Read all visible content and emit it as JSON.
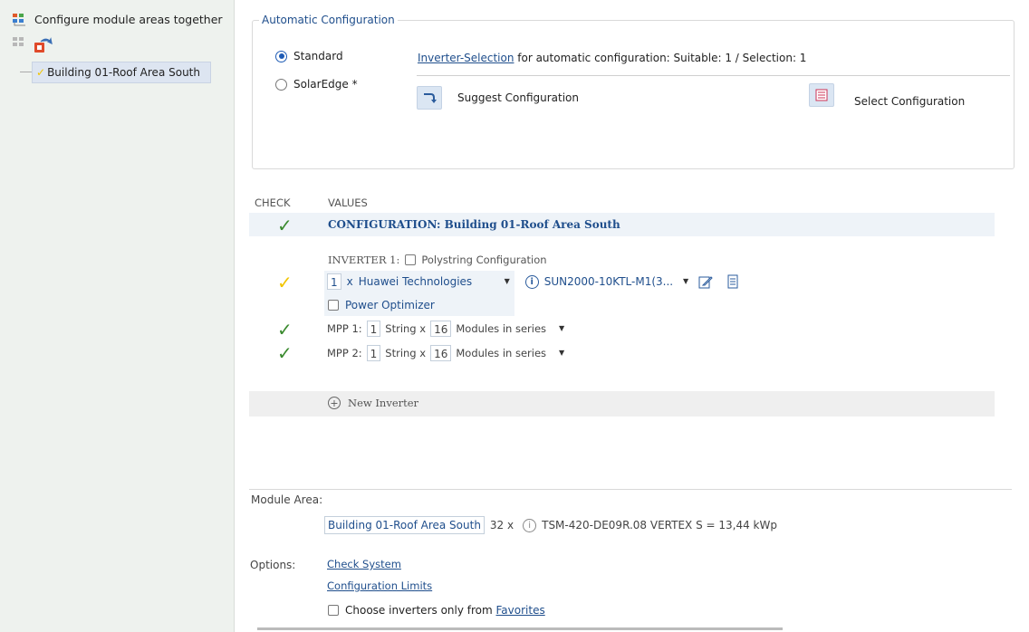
{
  "tree": {
    "title": "Configure module areas together",
    "node_label": "Building 01-Roof Area South"
  },
  "auto_config": {
    "legend": "Automatic Configuration",
    "radio_standard": "Standard",
    "radio_solaredge": "SolarEdge *",
    "inverter_selection_link": "Inverter-Selection",
    "inverter_selection_text": " for automatic configuration: Suitable: 1 / Selection: 1",
    "suggest_label": "Suggest Configuration",
    "select_label": "Select Configuration"
  },
  "check": {
    "col_check": "CHECK",
    "col_values": "VALUES",
    "config_title": "CONFIGURATION: Building 01-Roof Area South",
    "inverter_label": "INVERTER 1:",
    "polystring_label": "Polystring Configuration",
    "inverter_qty": "1",
    "times": "x",
    "manufacturer": "Huawei Technologies",
    "model": "SUN2000-10KTL-M1(3...",
    "power_optimizer_label": "Power Optimizer",
    "mpp": [
      {
        "label": "MPP 1:",
        "strings": "1",
        "string_x": "String x",
        "modules": "16",
        "modules_text": "Modules in series"
      },
      {
        "label": "MPP 2:",
        "strings": "1",
        "string_x": "String x",
        "modules": "16",
        "modules_text": "Modules in series"
      }
    ],
    "new_inverter_label": "New Inverter"
  },
  "module_area": {
    "label": "Module Area:",
    "area_name": "Building 01-Roof Area South",
    "count_text": "32  x",
    "module_text": "TSM-420-DE09R.08 VERTEX S  =  13,44 kWp"
  },
  "options": {
    "label": "Options:",
    "check_system": "Check System",
    "config_limits": "Configuration Limits",
    "favorites_text": "Choose inverters only from ",
    "favorites_link": "Favorites"
  },
  "colors": {
    "accent": "#1f4e8c",
    "check_ok": "#3a8a2e",
    "check_warn": "#f2c500"
  }
}
